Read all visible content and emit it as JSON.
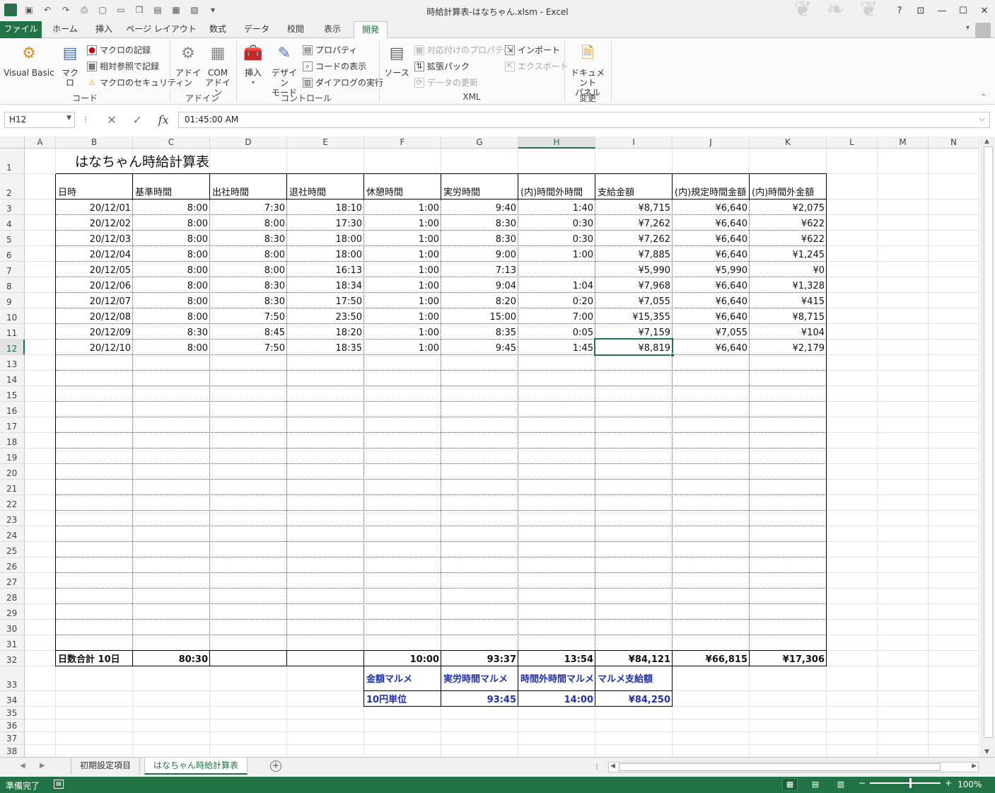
{
  "window": {
    "title": "時給計算表-はなちゃん.xlsm - Excel",
    "app_icon": "X",
    "help": "?",
    "controls": [
      "restore-ribbon",
      "minimize",
      "maximize",
      "close"
    ]
  },
  "qat": {
    "icons": [
      "save-icon",
      "undo-icon",
      "redo-icon",
      "print-preview-icon",
      "new-icon",
      "open-icon",
      "copy-icon",
      "paste-icon",
      "form-icon",
      "screenshot-icon"
    ]
  },
  "tabs": [
    "ファイル",
    "ホーム",
    "挿入",
    "ページ レイアウト",
    "数式",
    "データ",
    "校閲",
    "表示",
    "開発"
  ],
  "active_tab": "開発",
  "ribbon": {
    "code": {
      "group": "コード",
      "visual_basic": "Visual Basic",
      "macro": "マクロ",
      "record": "マクロの記録",
      "relative": "相対参照で記録",
      "security": "マクロのセキュリティ"
    },
    "addins": {
      "group": "アドイン",
      "addin": "アドイン",
      "com": "COM",
      "com2": "アドイン"
    },
    "controls": {
      "group": "コントロール",
      "insert": "挿入",
      "design": "デザイン",
      "design2": "モード",
      "properties": "プロパティ",
      "view_code": "コードの表示",
      "run_dialog": "ダイアログの実行"
    },
    "xml": {
      "group": "XML",
      "source": "ソース",
      "map_props": "対応付けのプロパティ",
      "expansion": "拡張パック",
      "refresh": "データの更新",
      "import": "インポート",
      "export": "エクスポート"
    },
    "modify": {
      "group": "変更",
      "doc_panel": "ドキュメント",
      "doc_panel2": "パネル"
    }
  },
  "formula_bar": {
    "name_box": "H12",
    "separator": "⁝",
    "value": "01:45:00 AM"
  },
  "grid": {
    "columns": [
      "A",
      "B",
      "C",
      "D",
      "E",
      "F",
      "G",
      "H",
      "I",
      "J",
      "K",
      "L",
      "M",
      "N"
    ],
    "selected_column": "H",
    "rows": [
      "1",
      "2",
      "3",
      "4",
      "5",
      "6",
      "7",
      "8",
      "9",
      "10",
      "11",
      "12",
      "13",
      "14",
      "15",
      "16",
      "17",
      "18",
      "19",
      "20",
      "21",
      "22",
      "23",
      "24",
      "25",
      "26",
      "27",
      "28",
      "29",
      "30",
      "31",
      "32",
      "33",
      "34",
      "35",
      "36",
      "37",
      "38"
    ],
    "selected_row": "12"
  },
  "sheet": {
    "title": "はなちゃん時給計算表",
    "headers": [
      "日時",
      "基準時間",
      "出社時間",
      "退社時間",
      "休憩時間",
      "実労時間",
      "(内)時間外時間",
      "支給金額",
      "(内)規定時間金額",
      "(内)時間外金額"
    ],
    "data": [
      [
        "20/12/01",
        "8:00",
        "7:30",
        "18:10",
        "1:00",
        "9:40",
        "1:40",
        "¥8,715",
        "¥6,640",
        "¥2,075"
      ],
      [
        "20/12/02",
        "8:00",
        "8:00",
        "17:30",
        "1:00",
        "8:30",
        "0:30",
        "¥7,262",
        "¥6,640",
        "¥622"
      ],
      [
        "20/12/03",
        "8:00",
        "8:30",
        "18:00",
        "1:00",
        "8:30",
        "0:30",
        "¥7,262",
        "¥6,640",
        "¥622"
      ],
      [
        "20/12/04",
        "8:00",
        "8:00",
        "18:00",
        "1:00",
        "9:00",
        "1:00",
        "¥7,885",
        "¥6,640",
        "¥1,245"
      ],
      [
        "20/12/05",
        "8:00",
        "8:00",
        "16:13",
        "1:00",
        "7:13",
        "",
        "¥5,990",
        "¥5,990",
        "¥0"
      ],
      [
        "20/12/06",
        "8:00",
        "8:30",
        "18:34",
        "1:00",
        "9:04",
        "1:04",
        "¥7,968",
        "¥6,640",
        "¥1,328"
      ],
      [
        "20/12/07",
        "8:00",
        "8:30",
        "17:50",
        "1:00",
        "8:20",
        "0:20",
        "¥7,055",
        "¥6,640",
        "¥415"
      ],
      [
        "20/12/08",
        "8:00",
        "7:50",
        "23:50",
        "1:00",
        "15:00",
        "7:00",
        "¥15,355",
        "¥6,640",
        "¥8,715"
      ],
      [
        "20/12/09",
        "8:30",
        "8:45",
        "18:20",
        "1:00",
        "8:35",
        "0:05",
        "¥7,159",
        "¥7,055",
        "¥104"
      ],
      [
        "20/12/10",
        "8:00",
        "7:50",
        "18:35",
        "1:00",
        "9:45",
        "1:45",
        "¥8,819",
        "¥6,640",
        "¥2,179"
      ]
    ],
    "totals": [
      "日数合計 10日",
      "80:30",
      "",
      "",
      "10:00",
      "93:37",
      "13:54",
      "¥84,121",
      "¥66,815",
      "¥17,306"
    ],
    "round_headers": [
      "金額マルメ",
      "実労時間マルメ",
      "時間外時間マルメ",
      "マルメ支給額"
    ],
    "round_values": [
      "10円単位",
      "93:45",
      "14:00",
      "¥84,250"
    ]
  },
  "sheet_tabs": [
    "初期設定項目",
    "はなちゃん時給計算表"
  ],
  "active_sheet": "はなちゃん時給計算表",
  "status": {
    "ready": "準備完了",
    "zoom": "100%"
  },
  "colors": {
    "accent": "#217346",
    "blue_text": "#1f2fb4"
  }
}
